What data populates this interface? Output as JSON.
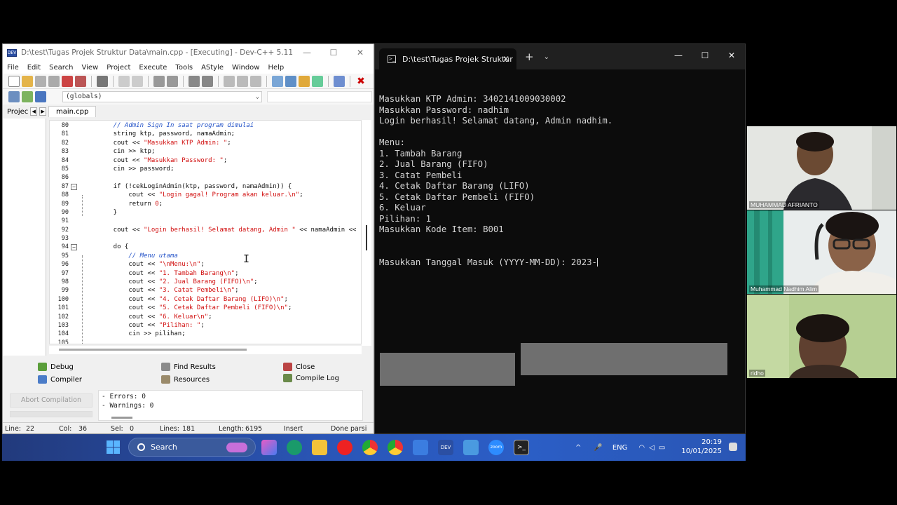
{
  "devcpp": {
    "title": "D:\\test\\Tugas Projek Struktur Data\\main.cpp - [Executing] - Dev-C++ 5.11",
    "menu": [
      "File",
      "Edit",
      "Search",
      "View",
      "Project",
      "Execute",
      "Tools",
      "AStyle",
      "Window",
      "Help"
    ],
    "scope_select": "(globals)",
    "project_tab": "Projec",
    "file_tab": "main.cpp",
    "code_lines": [
      {
        "n": "80",
        "t": "    // Admin Sign In saat program dimulai",
        "comment": true
      },
      {
        "n": "81",
        "t": "    string ktp, password, namaAdmin;"
      },
      {
        "n": "82",
        "a": "    cout << ",
        "s": "\"Masukkan KTP Admin: \"",
        "b": ";"
      },
      {
        "n": "83",
        "t": "    cin >> ktp;"
      },
      {
        "n": "84",
        "a": "    cout << ",
        "s": "\"Masukkan Password: \"",
        "b": ";"
      },
      {
        "n": "85",
        "t": "    cin >> password;"
      },
      {
        "n": "86",
        "t": ""
      },
      {
        "n": "87",
        "t": "    if (!cekLoginAdmin(ktp, password, namaAdmin)) {",
        "fold": true
      },
      {
        "n": "88",
        "a": "        cout << ",
        "s": "\"Login gagal! Program akan keluar.\\n\"",
        "b": ";"
      },
      {
        "n": "89",
        "a": "        return ",
        "s": "0",
        "b": ";"
      },
      {
        "n": "90",
        "t": "    }"
      },
      {
        "n": "91",
        "t": ""
      },
      {
        "n": "92",
        "a": "    cout << ",
        "s": "\"Login berhasil! Selamat datang, Admin \"",
        "b": " << namaAdmin <<"
      },
      {
        "n": "93",
        "t": ""
      },
      {
        "n": "94",
        "t": "    do {",
        "fold": true
      },
      {
        "n": "95",
        "t": "        // Menu utama",
        "comment": true
      },
      {
        "n": "96",
        "a": "        cout << ",
        "s": "\"\\nMenu:\\n\"",
        "b": ";"
      },
      {
        "n": "97",
        "a": "        cout << ",
        "s": "\"1. Tambah Barang\\n\"",
        "b": ";"
      },
      {
        "n": "98",
        "a": "        cout << ",
        "s": "\"2. Jual Barang (FIFO)\\n\"",
        "b": ";"
      },
      {
        "n": "99",
        "a": "        cout << ",
        "s": "\"3. Catat Pembeli\\n\"",
        "b": ";"
      },
      {
        "n": "100",
        "a": "        cout << ",
        "s": "\"4. Cetak Daftar Barang (LIFO)\\n\"",
        "b": ";"
      },
      {
        "n": "101",
        "a": "        cout << ",
        "s": "\"5. Cetak Daftar Pembeli (FIFO)\\n\"",
        "b": ";"
      },
      {
        "n": "102",
        "a": "        cout << ",
        "s": "\"6. Keluar\\n\"",
        "b": ";"
      },
      {
        "n": "103",
        "a": "        cout << ",
        "s": "\"Pilihan: \"",
        "b": ";"
      },
      {
        "n": "104",
        "t": "        cin >> pilihan;"
      },
      {
        "n": "105",
        "t": ""
      }
    ],
    "bottom_tabs": {
      "debug": "Debug",
      "find_results": "Find Results",
      "close": "Close",
      "compiler": "Compiler",
      "resources": "Resources",
      "compile_log": "Compile Log"
    },
    "abort_button": "Abort Compilation",
    "log": {
      "errors": "- Errors: 0",
      "warnings": "- Warnings: 0"
    },
    "status": {
      "line_label": "Line:",
      "line": "22",
      "col_label": "Col:",
      "col": "36",
      "sel_label": "Sel:",
      "sel": "0",
      "lines_label": "Lines:",
      "lines": "181",
      "length_label": "Length:",
      "length": "6195",
      "mode": "Insert",
      "parse": "Done parsi"
    }
  },
  "terminal": {
    "tab_title": "D:\\test\\Tugas Projek Struktur",
    "lines": [
      "Masukkan KTP Admin: 3402141009030002",
      "Masukkan Password: nadhim",
      "Login berhasil! Selamat datang, Admin nadhim.",
      "",
      "Menu:",
      "1. Tambah Barang",
      "2. Jual Barang (FIFO)",
      "3. Catat Pembeli",
      "4. Cetak Daftar Barang (LIFO)",
      "5. Cetak Daftar Pembeli (FIFO)",
      "6. Keluar",
      "Pilihan: 1",
      "Masukkan Kode Item: B001"
    ],
    "prompt_line": "Masukkan Tanggal Masuk (YYYY-MM-DD): 2023-"
  },
  "taskbar": {
    "search_placeholder": "Search",
    "language": "ENG",
    "time": "20:19",
    "date": "10/01/2025"
  },
  "participants": [
    {
      "name": "MUHAMMAD AFRIANTO"
    },
    {
      "name": "Muhammad Nadhim Alim"
    },
    {
      "name": "ridho"
    }
  ],
  "colors": {
    "code_comment": "#2453c8",
    "code_string": "#d10e0e",
    "terminal_bg": "#0c0c0c",
    "terminal_text": "#d6d6d6",
    "taskbar": "#2a56b8"
  }
}
